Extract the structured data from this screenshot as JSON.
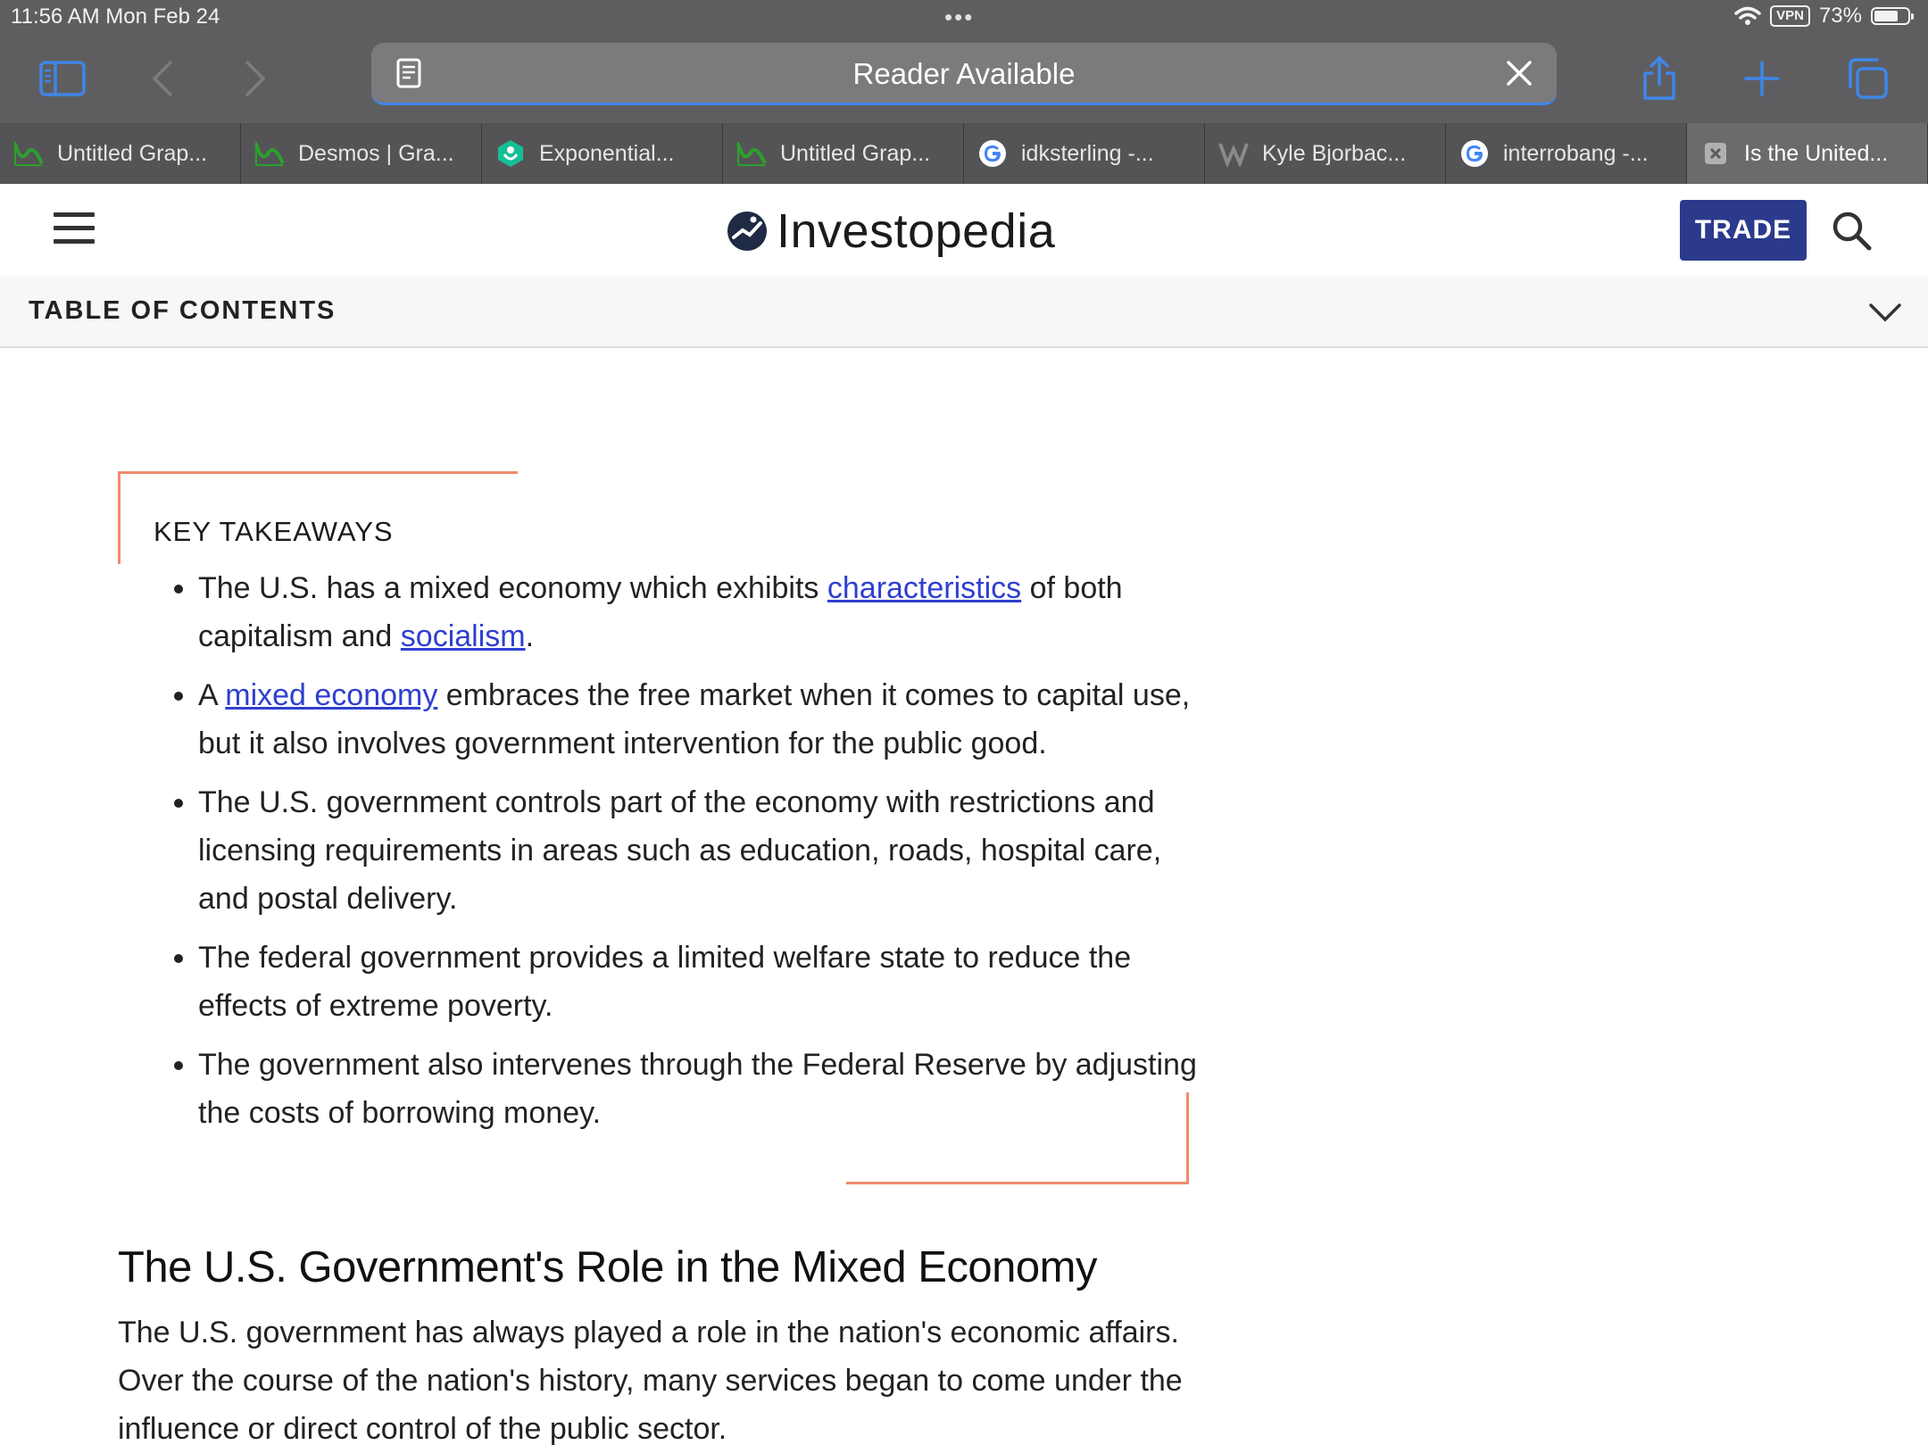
{
  "status_bar": {
    "time": "11:56 AM  Mon Feb 24",
    "more_dots": "•••",
    "vpn": "VPN",
    "battery_text": "73%",
    "battery_level": 0.73
  },
  "toolbar": {
    "address_text": "Reader Available"
  },
  "tabs": [
    {
      "title": "Untitled Grap...",
      "icon": "desmos-icon",
      "active": false
    },
    {
      "title": "Desmos | Gra...",
      "icon": "desmos-icon",
      "active": false
    },
    {
      "title": "Exponential...",
      "icon": "khan-academy-icon",
      "active": false
    },
    {
      "title": "Untitled Grap...",
      "icon": "desmos-icon",
      "active": false
    },
    {
      "title": "idksterling -...",
      "icon": "google-icon",
      "active": false
    },
    {
      "title": "Kyle Bjorbac...",
      "icon": "w-icon",
      "active": false
    },
    {
      "title": "interrobang -...",
      "icon": "google-icon",
      "active": false
    },
    {
      "title": "Is the United...",
      "icon": "close-tab-icon",
      "active": true
    }
  ],
  "header": {
    "logo_text": "Investopedia",
    "trade_label": "TRADE"
  },
  "toc": {
    "label": "TABLE OF CONTENTS"
  },
  "key_takeaways": {
    "title": "KEY TAKEAWAYS",
    "items": [
      {
        "before": "The U.S. has a mixed economy which exhibits ",
        "link1": "characteristics",
        "middle": " of both capitalism and ",
        "link2": "socialism",
        "after": "."
      },
      {
        "before": "A ",
        "link1": "mixed economy",
        "after": " embraces the free market when it comes to capital use, but it also involves government intervention for the public good."
      },
      {
        "text": "The U.S. government controls part of the economy with restrictions and licensing requirements in areas such as education, roads, hospital care, and postal delivery."
      },
      {
        "text": "The federal government provides a limited welfare state to reduce the effects of extreme poverty."
      },
      {
        "text": "The government also intervenes through the Federal Reserve by adjusting the costs of borrowing money."
      }
    ]
  },
  "section": {
    "heading": "The U.S. Government's Role in the Mixed Economy",
    "body": "The U.S. government has always played a role in the nation's economic affairs. Over the course of the nation's history, many services began to come under the influence or direct control of the public sector."
  },
  "colors": {
    "accent_orange": "#f08a6c",
    "link_blue": "#2f3fd0",
    "trade_blue": "#2c3a8c",
    "safari_blue": "#3f86e8"
  }
}
